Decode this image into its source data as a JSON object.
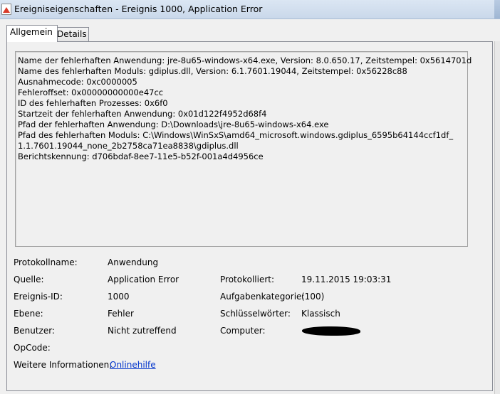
{
  "window": {
    "title": "Ereigniseigenschaften - Ereignis 1000, Application Error",
    "icon": "event-error-icon"
  },
  "tabs": [
    {
      "label": "Allgemein",
      "active": true
    },
    {
      "label": "Details",
      "active": false
    }
  ],
  "description": {
    "lines": [
      "Name der fehlerhaften Anwendung: jre-8u65-windows-x64.exe, Version: 8.0.650.17, Zeitstempel: 0x5614701d",
      "Name des fehlerhaften Moduls: gdiplus.dll, Version: 6.1.7601.19044, Zeitstempel: 0x56228c88",
      "Ausnahmecode: 0xc0000005",
      "Fehleroffset: 0x00000000000e47cc",
      "ID des fehlerhaften Prozesses: 0x6f0",
      "Startzeit der fehlerhaften Anwendung: 0x01d122f4952d68f4",
      "Pfad der fehlerhaften Anwendung: D:\\Downloads\\jre-8u65-windows-x64.exe",
      "Pfad des fehlerhaften Moduls: C:\\Windows\\WinSxS\\amd64_microsoft.windows.gdiplus_6595b64144ccf1df_",
      "1.1.7601.19044_none_2b2758ca71ea8838\\gdiplus.dll",
      "Berichtskennung: d706bdaf-8ee7-11e5-b52f-001a4d4956ce"
    ]
  },
  "fields": {
    "protokollname_label": "Protokollname:",
    "protokollname_value": "Anwendung",
    "quelle_label": "Quelle:",
    "quelle_value": "Application Error",
    "protokolliert_label": "Protokolliert:",
    "protokolliert_value": "19.11.2015 19:03:31",
    "ereignis_id_label": "Ereignis-ID:",
    "ereignis_id_value": "1000",
    "aufgabenkategorie_label": "Aufgabenkategorie:",
    "aufgabenkategorie_value": "(100)",
    "ebene_label": "Ebene:",
    "ebene_value": "Fehler",
    "schluesselwoerter_label": "Schlüsselwörter:",
    "schluesselwoerter_value": "Klassisch",
    "benutzer_label": "Benutzer:",
    "benutzer_value": "Nicht zutreffend",
    "computer_label": "Computer:",
    "opcode_label": "OpCode:",
    "weitere_label": "Weitere Informationen:",
    "weitere_link": "Onlinehilfe"
  },
  "colors": {
    "link": "#0033cc",
    "titlebar": "#dbe6f3"
  }
}
